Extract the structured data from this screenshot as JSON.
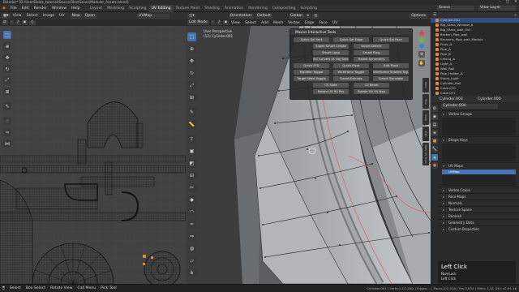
{
  "title": "Blender* [D:\\User\\Bolds_tutorial\\SourceFiles\\Saves\\Modular_Assets.blend]",
  "window_controls": [
    "–",
    "□",
    "✕"
  ],
  "menu": [
    "File",
    "Edit",
    "Render",
    "Window",
    "Help"
  ],
  "workspaces": [
    "Layout",
    "Modeling",
    "Sculpting",
    "UV Editing",
    "Texture Paint",
    "Shading",
    "Animation",
    "Rendering",
    "Compositing",
    "Scripting"
  ],
  "active_workspace": "UV Editing",
  "scene_label": "Scene",
  "viewlayer_label": "View Layer",
  "uv": {
    "mode": "UV Editor",
    "menus": [
      "View",
      "Select",
      "Image",
      "UV"
    ],
    "sync": "UVMap",
    "image_buttons": [
      "New",
      "Open"
    ],
    "uvmap_label": "UVMap"
  },
  "viewport": {
    "mode": "Edit Mode",
    "menus": [
      "View",
      "Select",
      "Add",
      "Mesh",
      "Vertex",
      "Edge",
      "Face",
      "UV"
    ],
    "orientation_label": "Orientation:",
    "orientation": "Default",
    "transform": "Global",
    "options": "Options",
    "perspective": "User Perspective",
    "object": "(12) Cylinder.001"
  },
  "pie_menu": {
    "title": "Maxivz Interactive Tools",
    "buttons": [
      [
        "Quick Sel Vert",
        "Quick Sel Edge",
        "Quick Sel Face"
      ],
      [
        "Super Smart Create",
        "",
        "Smart Delete"
      ],
      [
        "Smart Loop",
        "",
        "Smart Ring"
      ],
      [
        "Sel Curvels vs Obj Select",
        "",
        "Radial Symmetry"
      ],
      [
        "Quick FFD",
        "Quick Pivot",
        "Edit Pivot"
      ],
      [
        "Modifier Toggle",
        "Wireframe Toggle",
        "Wireframe Shaded Tog."
      ],
      [
        "Target Weld Toggle",
        "Smart Extrude",
        "Smart Translate"
      ],
      [
        "",
        "CS Slide",
        "CS Bevel"
      ],
      [
        "Rotate UV 90 Pos",
        "",
        "Rotate UV 90 Neg"
      ]
    ]
  },
  "side_tabs": [
    "Item",
    "Tool",
    "View",
    "Edit",
    "Mark UV Tools"
  ],
  "outliner": {
    "items": [
      {
        "name": "Cylinder.001",
        "selected": true
      },
      {
        "name": "Big_Glass_Window_b",
        "selected": false
      },
      {
        "name": "Big_Glass_wall_Oct",
        "selected": false
      },
      {
        "name": "Broken_Pipe_wall",
        "selected": false
      },
      {
        "name": "Bronwns_Pipe_wall_Module",
        "selected": false
      },
      {
        "name": "Floor_A",
        "selected": false
      },
      {
        "name": "Pipe_A",
        "selected": false
      },
      {
        "name": "Pipe_B",
        "selected": false
      },
      {
        "name": "Ceiling_A",
        "selected": false
      },
      {
        "name": "Light_A",
        "selected": false
      },
      {
        "name": "Wall_Rail",
        "selected": false
      },
      {
        "name": "Pipe_Holder_A",
        "selected": false
      },
      {
        "name": "Stairs_Light",
        "selected": false
      },
      {
        "name": "Cylinder_Rail",
        "selected": false
      },
      {
        "name": "Cube.070",
        "selected": false
      },
      {
        "name": "Cube.071",
        "selected": false
      }
    ]
  },
  "properties": {
    "object_name": "Cylinder.003",
    "mesh_name": "Cylinder.000",
    "sections_top": [
      "Vertex Groups",
      "Shape Keys",
      "UV Maps"
    ],
    "uvmap_entry": "UVMap",
    "sections_bottom": [
      "Vertex Colors",
      "Face Maps",
      "Normals",
      "Texture Space",
      "Remesh",
      "Geometry Data",
      "Custom Properties"
    ]
  },
  "last_op": {
    "title": "Left Click",
    "line1": "NumLock",
    "line2": "Left Click"
  },
  "status": {
    "left": [
      "Select",
      "Box Select",
      "Rotate View",
      "Call Menu",
      "Pick Tool"
    ],
    "right": "Cylinder.001 | Verts:1,1/2,062 | Edges:... | Faces:2/2,918 | Tris:5,834 | Mem: 1.01 GB | v2.91.16"
  },
  "colors": {
    "accent": "#4772b3",
    "selection": "#e08b3a",
    "header": "#303030",
    "mesh": "#b9bcbf",
    "uv_bg": "#424242"
  }
}
